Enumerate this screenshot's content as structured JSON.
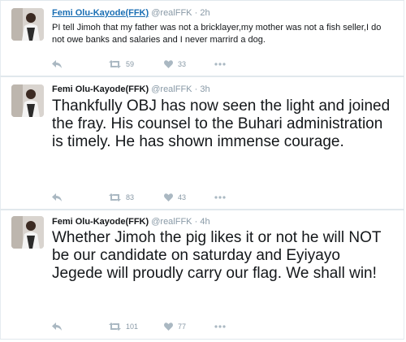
{
  "tweets": [
    {
      "fullname": "Femi Olu-Kayode(FFK)",
      "username": "@realFFK",
      "sep": "·",
      "time": "2h",
      "text": "PI tell Jimoh that my father was not a bricklayer,my mother was not a fish seller,I do not owe banks and salaries and I never marrird a dog.",
      "retweets": "59",
      "likes": "33"
    },
    {
      "fullname": "Femi Olu-Kayode(FFK)",
      "username": "@realFFK",
      "sep": "·",
      "time": "3h",
      "text": "Thankfully OBJ has now seen the light and joined the fray. His counsel to the Buhari administration is timely. He has shown immense courage.",
      "retweets": "83",
      "likes": "43"
    },
    {
      "fullname": "Femi Olu-Kayode(FFK)",
      "username": "@realFFK",
      "sep": "·",
      "time": "4h",
      "text": "Whether Jimoh the pig likes it or not he will NOT be our candidate on saturday and Eyiyayo Jegede will proudly carry our flag. We shall win!",
      "retweets": "101",
      "likes": "77"
    }
  ],
  "icons": {
    "reply": "reply-icon",
    "retweet": "retweet-icon",
    "like": "heart-icon",
    "more": "more-icon"
  },
  "colors": {
    "link_blue": "#1b6fb4",
    "icon_gray": "#aab8c2",
    "muted_text": "#8899a6"
  }
}
